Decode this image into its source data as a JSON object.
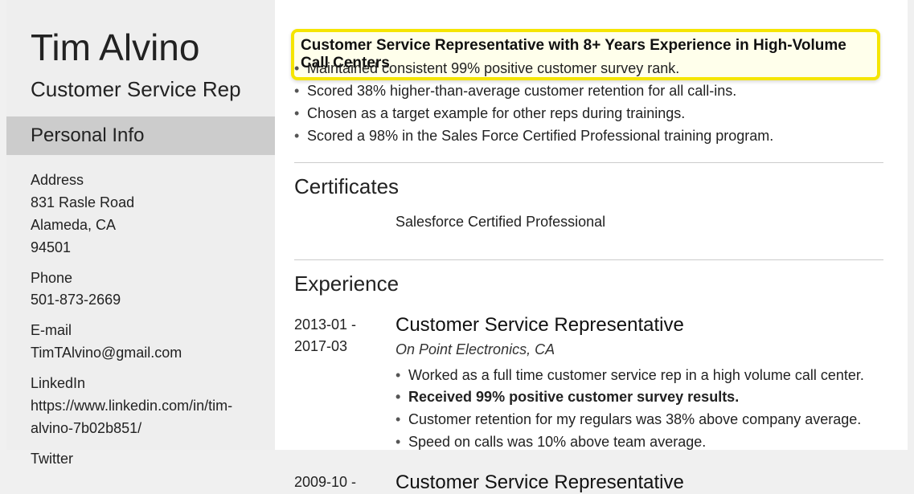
{
  "sidebar": {
    "name": "Tim Alvino",
    "title": "Customer Service Rep",
    "personal_info_header": "Personal Info",
    "address_label": "Address",
    "address_line1": "831 Rasle Road",
    "address_line2": "Alameda, CA",
    "address_zip": "94501",
    "phone_label": "Phone",
    "phone_value": "501-873-2669",
    "email_label": "E-mail",
    "email_value": "TimTAlvino@gmail.com",
    "linkedin_label": "LinkedIn",
    "linkedin_value": "https://www.linkedin.com/in/tim-alvino-7b02b851/",
    "twitter_label": "Twitter"
  },
  "main": {
    "highlight": "Customer Service Representative with 8+ Years Experience in High-Volume Call Centers",
    "summary_bullets": [
      "Maintained consistent 99% positive customer survey rank.",
      "Scored 38% higher-than-average customer retention for all call-ins.",
      "Chosen as a target example for other reps during trainings.",
      "Scored a 98% in the Sales Force Certified Professional training program."
    ],
    "certificates_header": "Certificates",
    "certificate_value": "Salesforce Certified Professional",
    "experience_header": "Experience",
    "jobs": [
      {
        "dates": "2013-01 - 2017-03",
        "title": "Customer Service Representative",
        "company": "On Point Electronics, CA",
        "bullets": [
          {
            "text": "Worked as a full time customer service rep in a high volume call center.",
            "bold": false
          },
          {
            "text": "Received 99% positive customer survey results.",
            "bold": true
          },
          {
            "text": "Customer retention for my regulars was 38% above company average.",
            "bold": false
          },
          {
            "text": "Speed on calls was 10% above team average.",
            "bold": false
          }
        ]
      },
      {
        "dates": "2009-10 -",
        "title": "Customer Service Representative",
        "company": "",
        "bullets": []
      }
    ]
  }
}
